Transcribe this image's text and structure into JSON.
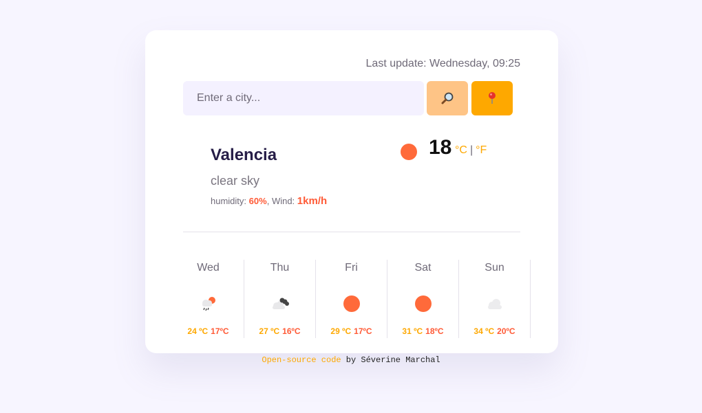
{
  "header": {
    "last_update": "Last update: Wednesday, 09:25"
  },
  "search": {
    "placeholder": "Enter a city...",
    "value": "",
    "search_icon": "magnifier-icon",
    "locate_icon": "pin-icon"
  },
  "current": {
    "city": "Valencia",
    "description": "clear sky",
    "humidity_label": "humidity:",
    "humidity_value": "60%",
    "wind_label": "Wind:",
    "wind_value": "1km/h",
    "temperature": "18",
    "unit_c": "°C",
    "unit_sep": "|",
    "unit_f": "°F",
    "icon": "sun-icon"
  },
  "forecast": [
    {
      "day": "Wed",
      "icon": "rain-sun-icon",
      "max": "24 ºC",
      "min": "17ºC"
    },
    {
      "day": "Thu",
      "icon": "broken-clouds-icon",
      "max": "27 ºC",
      "min": "16ºC"
    },
    {
      "day": "Fri",
      "icon": "sun-icon",
      "max": "29 ºC",
      "min": "17ºC"
    },
    {
      "day": "Sat",
      "icon": "sun-icon",
      "max": "31 ºC",
      "min": "18ºC"
    },
    {
      "day": "Sun",
      "icon": "cloud-icon",
      "max": "34 ºC",
      "min": "20ºC"
    }
  ],
  "footer": {
    "link_text": "Open-source code",
    "byline": "by Séverine Marchal"
  },
  "colors": {
    "accent": "#fea800",
    "accent_light": "#fec486",
    "hot": "#ff5a36",
    "background": "#f7f5ff"
  }
}
